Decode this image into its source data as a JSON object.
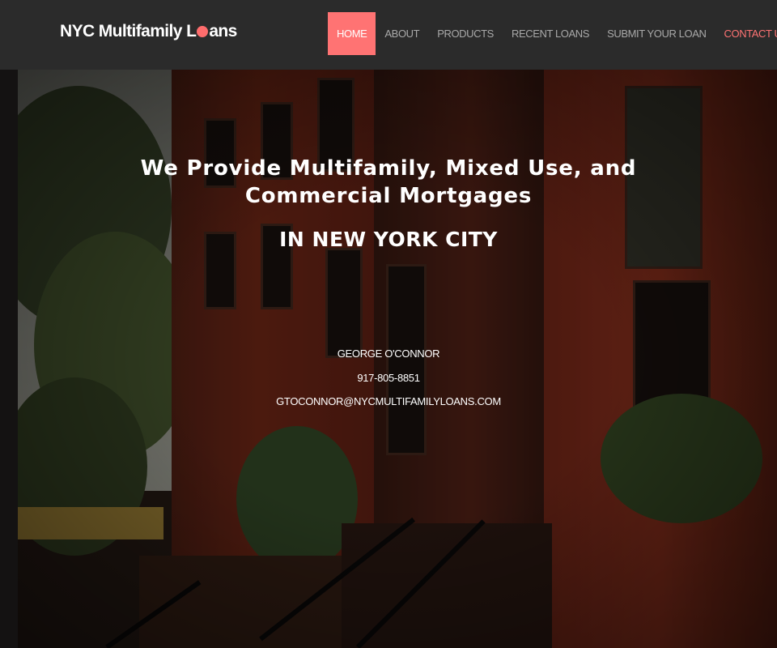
{
  "brand": {
    "before_dot": "NYC Multifamily L",
    "after_dot": "ans"
  },
  "nav": {
    "items": [
      {
        "label": "HOME"
      },
      {
        "label": "ABOUT"
      },
      {
        "label": "PRODUCTS"
      },
      {
        "label": "RECENT LOANS"
      },
      {
        "label": "SUBMIT YOUR LOAN"
      },
      {
        "label": "CONTACT US"
      }
    ]
  },
  "hero": {
    "title_line1": "We Provide Multifamily, Mixed Use, and",
    "title_line2": "Commercial Mortgages",
    "subtitle": "IN NEW YORK CITY",
    "contact_name": "GEORGE O'CONNOR",
    "contact_phone": "917-805-8851",
    "contact_email": "GTOCONNOR@NYCMULTIFAMILYLOANS.COM"
  },
  "colors": {
    "accent": "#ff7373",
    "nav_bg": "#2b2b2b",
    "nav_text": "#a9a9a9"
  }
}
